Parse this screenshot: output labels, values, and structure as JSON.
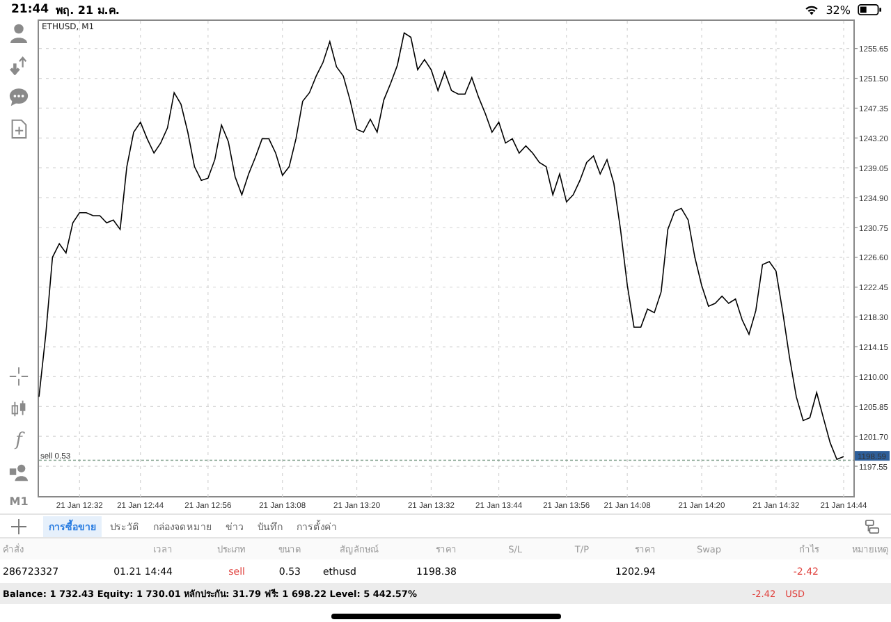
{
  "status_bar": {
    "time": "21:44",
    "date": "พฤ. 21 ม.ค.",
    "battery": "32%"
  },
  "toolbar": {
    "function_glyph": "f",
    "timeframe": "M1"
  },
  "chart": {
    "chart_data": {
      "type": "line",
      "title": "ETHUSD, M1",
      "grid": true,
      "ylim": [
        1193.3,
        1259.1
      ],
      "categories": [
        null,
        null,
        null,
        null,
        null,
        null,
        "21 Jan 12:32",
        null,
        null,
        null,
        null,
        null,
        null,
        null,
        null,
        "21 Jan 12:44",
        null,
        null,
        null,
        null,
        null,
        null,
        null,
        null,
        null,
        "21 Jan 12:56",
        null,
        null,
        null,
        null,
        null,
        null,
        null,
        null,
        null,
        null,
        "21 Jan 13:08",
        null,
        null,
        null,
        null,
        null,
        null,
        null,
        null,
        null,
        null,
        "21 Jan 13:20",
        null,
        null,
        null,
        null,
        null,
        null,
        null,
        null,
        null,
        null,
        "21 Jan 13:32",
        null,
        null,
        null,
        null,
        null,
        null,
        null,
        null,
        null,
        "21 Jan 13:44",
        null,
        null,
        null,
        null,
        null,
        null,
        null,
        null,
        null,
        "21 Jan 13:56",
        null,
        null,
        null,
        null,
        null,
        null,
        null,
        null,
        "21 Jan 14:08",
        null,
        null,
        null,
        null,
        null,
        null,
        null,
        null,
        null,
        null,
        "21 Jan 14:20",
        null,
        null,
        null,
        null,
        null,
        null,
        null,
        null,
        null,
        null,
        "21 Jan 14:32",
        null,
        null,
        null,
        null,
        null,
        null,
        null,
        null,
        null,
        "21 Jan 14:44"
      ],
      "series": [
        {
          "color": "#000000",
          "values": [
            1207.2,
            1215.9,
            1226.6,
            1228.5,
            1227.2,
            1231.4,
            1232.8,
            1232.8,
            1232.4,
            1232.4,
            1231.4,
            1231.8,
            1230.5,
            1239.2,
            1244.0,
            1245.4,
            1243.1,
            1241.1,
            1242.5,
            1244.6,
            1249.5,
            1247.9,
            1244.0,
            1239.2,
            1237.3,
            1237.6,
            1240.2,
            1245.0,
            1242.7,
            1237.8,
            1235.3,
            1238.2,
            1240.5,
            1243.1,
            1243.1,
            1241.1,
            1238.0,
            1239.2,
            1243.1,
            1248.3,
            1249.5,
            1251.8,
            1253.7,
            1256.6,
            1253.1,
            1251.8,
            1248.5,
            1244.4,
            1244.0,
            1245.8,
            1244.0,
            1248.5,
            1250.8,
            1253.3,
            1257.8,
            1257.2,
            1252.7,
            1254.1,
            1252.7,
            1249.8,
            1252.4,
            1249.8,
            1249.3,
            1249.3,
            1251.6,
            1248.9,
            1246.6,
            1244.0,
            1245.4,
            1242.5,
            1243.1,
            1241.1,
            1242.1,
            1241.1,
            1239.8,
            1239.2,
            1235.3,
            1238.2,
            1234.3,
            1235.3,
            1237.3,
            1239.8,
            1240.7,
            1238.2,
            1240.2,
            1236.9,
            1230.5,
            1222.7,
            1216.9,
            1216.9,
            1219.4,
            1218.9,
            1221.8,
            1230.5,
            1233.0,
            1233.4,
            1231.8,
            1226.6,
            1222.7,
            1219.8,
            1220.2,
            1221.2,
            1220.2,
            1220.8,
            1217.9,
            1215.9,
            1219.2,
            1225.6,
            1226.0,
            1224.7,
            1218.9,
            1212.7,
            1207.2,
            1203.9,
            1204.3,
            1207.8,
            1204.3,
            1200.8,
            1198.5,
            1198.9
          ]
        }
      ],
      "yticks": [
        {
          "value": 1255.65,
          "label": "1255.65"
        },
        {
          "value": 1251.5,
          "label": "1251.50"
        },
        {
          "value": 1247.35,
          "label": "1247.35"
        },
        {
          "value": 1243.2,
          "label": "1243.20"
        },
        {
          "value": 1239.05,
          "label": "1239.05"
        },
        {
          "value": 1234.9,
          "label": "1234.90"
        },
        {
          "value": 1230.75,
          "label": "1230.75"
        },
        {
          "value": 1226.6,
          "label": "1226.60"
        },
        {
          "value": 1222.45,
          "label": "1222.45"
        },
        {
          "value": 1218.3,
          "label": "1218.30"
        },
        {
          "value": 1214.15,
          "label": "1214.15"
        },
        {
          "value": 1210,
          "label": "1210.00"
        },
        {
          "value": 1205.85,
          "label": "1205.85"
        },
        {
          "value": 1201.7,
          "label": "1201.70"
        },
        {
          "value": 1197.55,
          "label": "1197.55"
        }
      ],
      "ref_lines": [
        {
          "axis": "y",
          "value": 1198.38,
          "label": "sell 0.53"
        }
      ]
    },
    "price_tag": {
      "text": "1198.59"
    }
  },
  "tabs": [
    {
      "label": "การซื้อขาย",
      "selected": true
    },
    {
      "label": "ประวัติ",
      "selected": false
    },
    {
      "label": "กล่องจดหมาย",
      "selected": false
    },
    {
      "label": "ข่าว",
      "selected": false
    },
    {
      "label": "บันทึก",
      "selected": false
    },
    {
      "label": "การตั้งค่า",
      "selected": false
    }
  ],
  "table": {
    "columns": [
      "คำสั่ง",
      "เวลา",
      "ประเภท",
      "ขนาด",
      "สัญลักษณ์",
      "ราคา",
      "S/L",
      "T/P",
      "ราคา",
      "Swap",
      "กำไร",
      "หมายเหตุ"
    ],
    "rows": [
      {
        "cells": [
          {
            "text": "286723327",
            "negative": false
          },
          {
            "text": "01.21 14:44",
            "negative": false
          },
          {
            "text": "sell",
            "negative": true
          },
          {
            "text": "0.53",
            "negative": false
          },
          {
            "text": "ethusd",
            "negative": false
          },
          {
            "text": "1198.38",
            "negative": false
          },
          null,
          null,
          {
            "text": "1202.94",
            "negative": false
          },
          null,
          {
            "text": "-2.42",
            "negative": true
          },
          null
        ]
      }
    ]
  },
  "summary": {
    "text": "Balance: 1 732.43 Equity: 1 730.01 หลักประกัน: 31.79 ฟรี: 1 698.22 Level: 5 442.57%",
    "profit": "-2.42",
    "currency": "USD"
  }
}
